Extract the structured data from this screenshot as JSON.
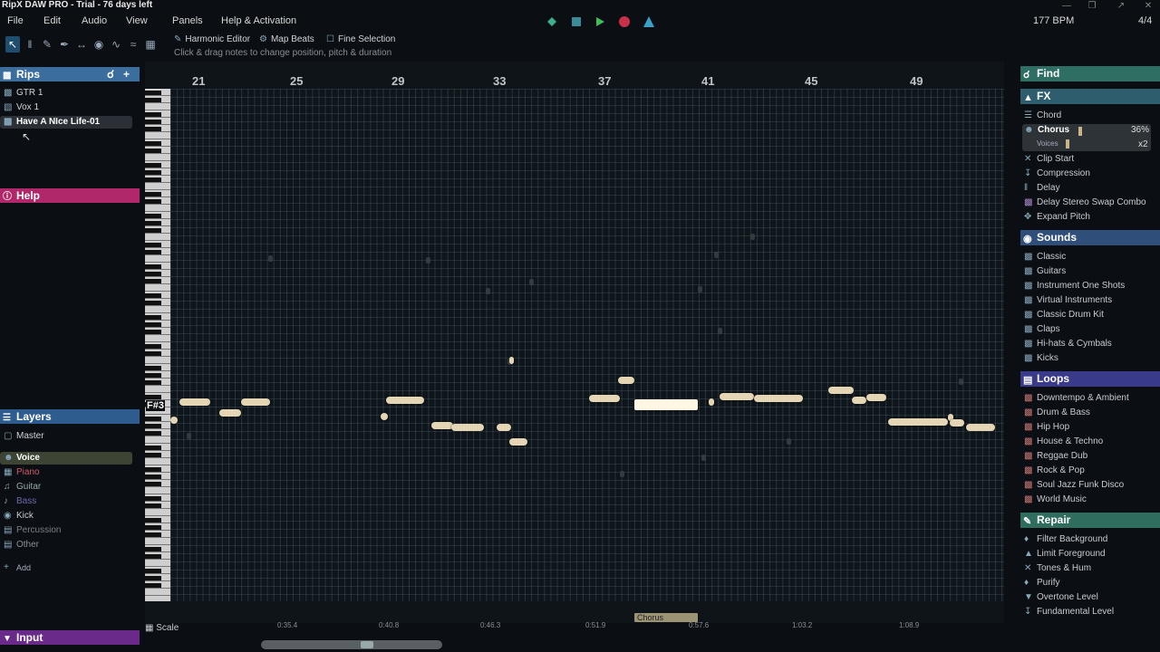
{
  "window": {
    "title": "RipX DAW PRO - Trial - 76 days left"
  },
  "menu": [
    "File",
    "Edit",
    "Audio",
    "View",
    "Panels",
    "Help & Activation"
  ],
  "status": {
    "bpm": "177 BPM",
    "time_signature": "4/4"
  },
  "modes": {
    "harmonic_editor": "Harmonic Editor",
    "map_beats": "Map Beats",
    "fine_selection": "Fine Selection"
  },
  "hint": "Click & drag notes to change position, pitch & duration",
  "rips": {
    "title": "Rips",
    "items": [
      "GTR 1",
      "Vox 1",
      "Have A NIce Life-01"
    ]
  },
  "help": {
    "title": "Help"
  },
  "layers": {
    "title": "Layers",
    "master": "Master",
    "items": [
      "Voice",
      "Piano",
      "Guitar",
      "Bass",
      "Kick",
      "Percussion",
      "Other"
    ],
    "add": "Add"
  },
  "input": {
    "title": "Input"
  },
  "ruler": {
    "bars": [
      "21",
      "25",
      "29",
      "33",
      "37",
      "41",
      "45",
      "49"
    ]
  },
  "note_label": "F#3",
  "time_axis": [
    "0:35.4",
    "0:40.8",
    "0:46.3",
    "0:51.9",
    "0:57.6",
    "1:03.2",
    "1:08.9"
  ],
  "clip": {
    "label": "Chorus"
  },
  "scale_label": "Scale",
  "find": {
    "title": "Find"
  },
  "fx": {
    "title": "FX",
    "items": [
      "Chord",
      "Chorus",
      "Clip Start",
      "Compression",
      "Delay",
      "Delay Stereo Swap Combo",
      "Expand Pitch"
    ],
    "chorus_amount": "36%",
    "voices_label": "Voices",
    "voices_value": "x2",
    "chorus_fill": 0.36
  },
  "sounds": {
    "title": "Sounds",
    "items": [
      "Classic",
      "Guitars",
      "Instrument One Shots",
      "Virtual Instruments",
      "Classic Drum Kit",
      "Claps",
      "Hi-hats & Cymbals",
      "Kicks"
    ]
  },
  "loops": {
    "title": "Loops",
    "items": [
      "Downtempo & Ambient",
      "Drum & Bass",
      "Hip Hop",
      "House & Techno",
      "Reggae Dub",
      "Rock & Pop",
      "Soul Jazz Funk Disco",
      "World Music"
    ]
  },
  "repair": {
    "title": "Repair",
    "items": [
      "Filter Background",
      "Limit Foreground",
      "Tones & Hum",
      "Purify",
      "Overtone Level",
      "Fundamental Level"
    ]
  },
  "colors": {
    "rips": "#3b6e9e",
    "help": "#b0286a",
    "layers": "#2f5c8f",
    "input": "#6a2a8a",
    "find": "#2f6e62",
    "fx": "#2e5e6e",
    "sounds": "#2f4e7a",
    "loops": "#3a3a8a",
    "repair": "#2f6e5e"
  }
}
